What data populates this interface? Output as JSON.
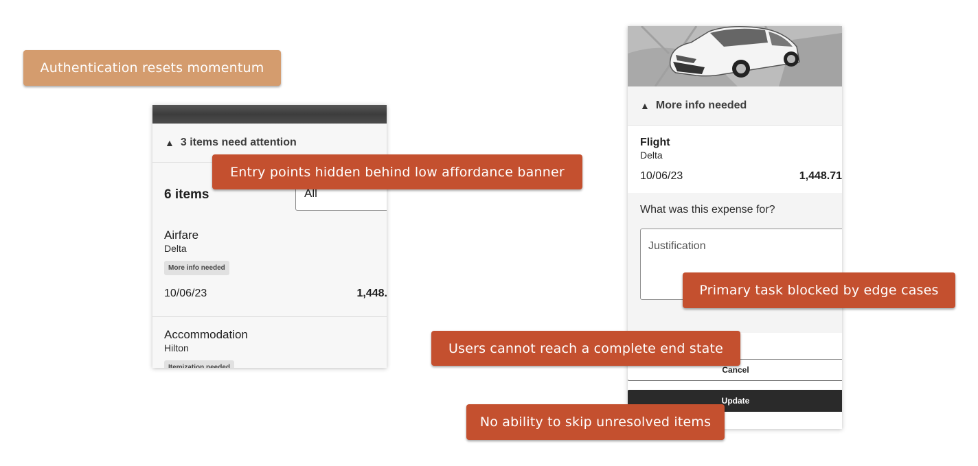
{
  "callouts": {
    "auth": "Authentication resets momentum",
    "entry": "Entry points hidden behind low affordance banner",
    "primary": "Primary task blocked by edge cases",
    "end_state": "Users cannot reach a complete end state",
    "skip": "No ability to skip unresolved items"
  },
  "left_panel": {
    "attention_text": "3 items need attention",
    "count_title": "6 items",
    "filter_value": "All",
    "items": [
      {
        "title": "Airfare",
        "vendor": "Delta",
        "badge": "More info needed",
        "date": "10/06/23",
        "amount": "1,448."
      },
      {
        "title": "Accommodation",
        "vendor": "Hilton",
        "badge": "Itemization needed"
      }
    ]
  },
  "right_panel": {
    "status_text": "More info needed",
    "flight": {
      "title": "Flight",
      "vendor": "Delta",
      "date": "10/06/23",
      "amount": "1,448.71"
    },
    "question": "What was this expense for?",
    "justification_placeholder": "Justification",
    "cancel_label": "Cancel",
    "update_label": "Update"
  },
  "colors": {
    "callout_red": "#c4502f",
    "callout_tan": "#d49c6e",
    "button_dark": "#2a2a2a"
  },
  "icons": {
    "warning": "warning-triangle-icon",
    "car": "car-illustration"
  }
}
